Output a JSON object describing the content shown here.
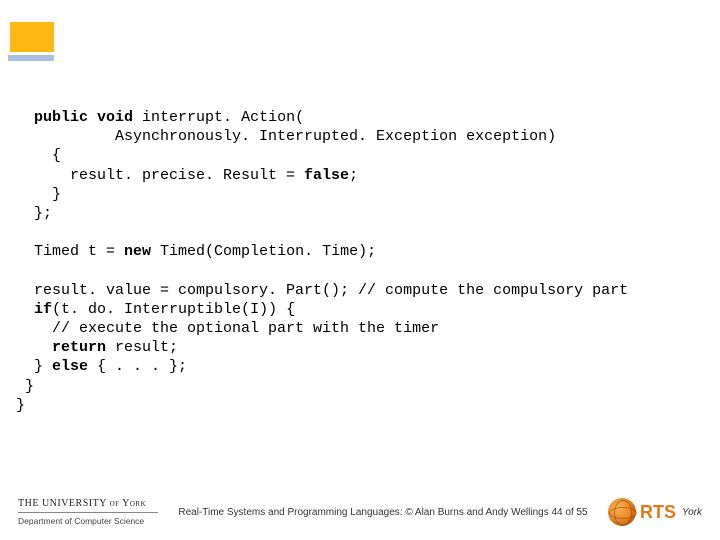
{
  "code": {
    "l01a": "  ",
    "l01k1": "public void",
    "l01b": " interrupt. Action(",
    "l02": "           Asynchronously. Interrupted. Exception exception)",
    "l03": "    {",
    "l04a": "      result. precise. Result = ",
    "l04k": "false",
    "l04b": ";",
    "l05": "    }",
    "l06": "  };",
    "blank1": "",
    "l07a": "  Timed t = ",
    "l07k": "new",
    "l07b": " Timed(Completion. Time);",
    "blank2": "",
    "l08": "  result. value = compulsory. Part(); // compute the compulsory part",
    "l09a": "  ",
    "l09k": "if",
    "l09b": "(t. do. Interruptible(I)) {",
    "l10": "    // execute the optional part with the timer",
    "l11a": "    ",
    "l11k": "return",
    "l11b": " result;",
    "l12a": "  } ",
    "l12k": "else",
    "l12b": " { . . . };",
    "l13": " }",
    "l14": "}"
  },
  "footer": {
    "uni_top": "THE UNIVERSITY of York",
    "uni_bottom": "Department of Computer Science",
    "copyright": "Real-Time Systems and Programming Languages: © Alan Burns and Andy Wellings 44 of 55",
    "rts": "RTS",
    "rts_sub": "York"
  }
}
